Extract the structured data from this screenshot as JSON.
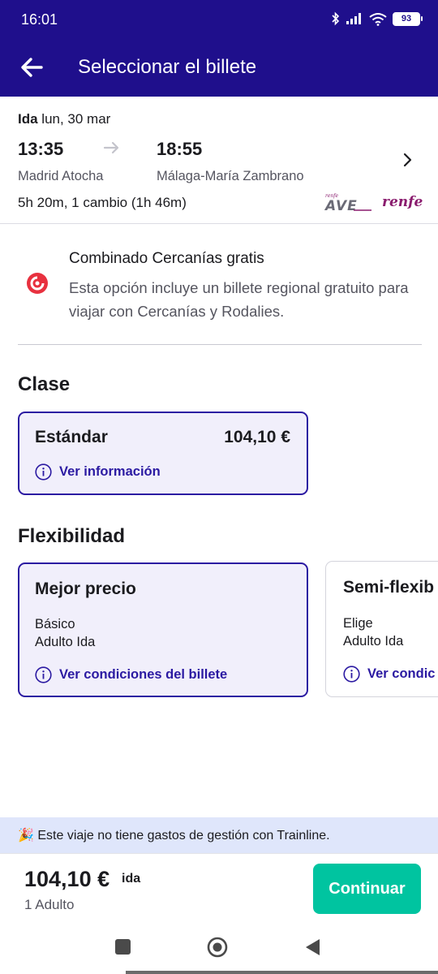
{
  "status": {
    "time": "16:01",
    "battery": "93"
  },
  "appbar": {
    "title": "Seleccionar el billete"
  },
  "journey": {
    "direction": "Ida",
    "date": "lun, 30 mar",
    "dep_time": "13:35",
    "arr_time": "18:55",
    "from": "Madrid Atocha",
    "to": "Málaga-María Zambrano",
    "duration": "5h 20m, 1 cambio (1h 46m)",
    "brand_small": "renfe",
    "brand_ave": "AVE",
    "brand_renfe": "renfe"
  },
  "promo": {
    "title": "Combinado Cercanías gratis",
    "description": "Esta opción incluye un billete regional gratuito para viajar con Cercanías y Rodalies."
  },
  "clase": {
    "heading": "Clase",
    "label": "Estándar",
    "price": "104,10 €",
    "link": "Ver información"
  },
  "flex": {
    "heading": "Flexibilidad",
    "options": [
      {
        "label": "Mejor precio",
        "line1": "Básico",
        "line2": "Adulto Ida",
        "link": "Ver condiciones del billete"
      },
      {
        "label": "Semi-flexib",
        "line1": "Elige",
        "line2": "Adulto Ida",
        "link": "Ver condic"
      }
    ]
  },
  "notice": {
    "emoji": "🎉",
    "text": "Este viaje no tiene gastos de gestión con Trainline."
  },
  "footer": {
    "total": "104,10 €",
    "trip": "ida",
    "pax": "1 Adulto",
    "cta": "Continuar"
  },
  "colors": {
    "brand": "#1f0f8c",
    "accent": "#2b1aa2",
    "cta": "#00c4a0",
    "card_bg": "#f1effb",
    "notice_bg": "#dfe6fb"
  }
}
